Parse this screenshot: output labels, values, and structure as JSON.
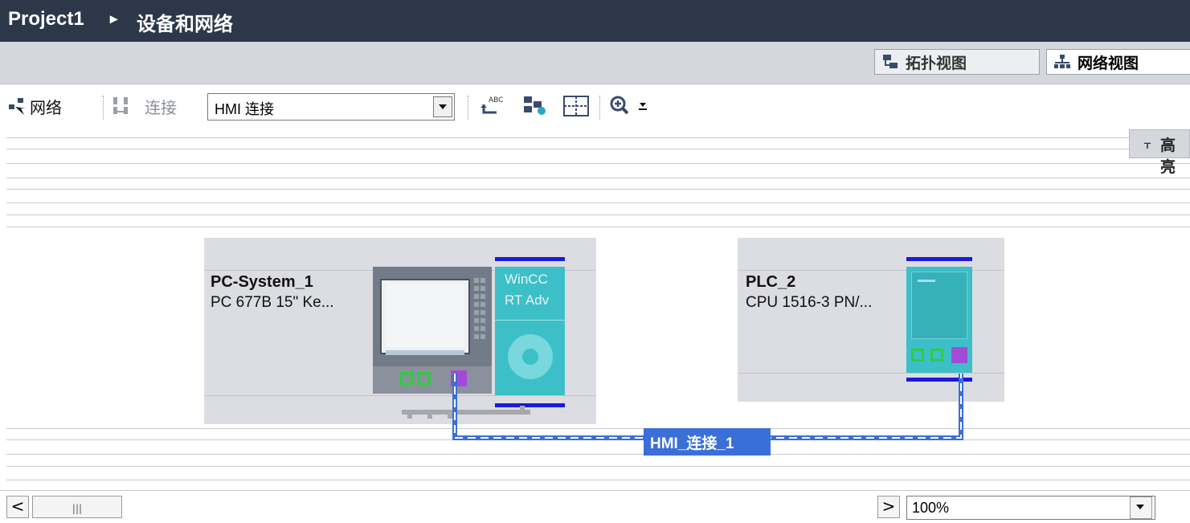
{
  "titlebar": {
    "project": "Project1",
    "separator": "▸",
    "page": "设备和网络"
  },
  "view_tabs": {
    "topology": "拓扑视图",
    "network": "网络视图"
  },
  "toolbar": {
    "network_label": "网络",
    "connections_label": "连接",
    "connection_type": "HMI 连接"
  },
  "side_panel": {
    "label": "高亮"
  },
  "devices": {
    "pc": {
      "name": "PC-System_1",
      "type": "PC 677B 15\" Ke...",
      "app_line1": "WinCC",
      "app_line2": "RT Adv"
    },
    "plc": {
      "name": "PLC_2",
      "type": "CPU 1516-3 PN/..."
    }
  },
  "connection": {
    "label": "HMI_连接_1"
  },
  "statusbar": {
    "zoom": "100%",
    "scroll_grip": "|||"
  },
  "colors": {
    "titlebar": "#2c3749",
    "connection": "#3a6fd8",
    "accent_blue": "#1a1adb",
    "teal": "#3dbfc8"
  }
}
